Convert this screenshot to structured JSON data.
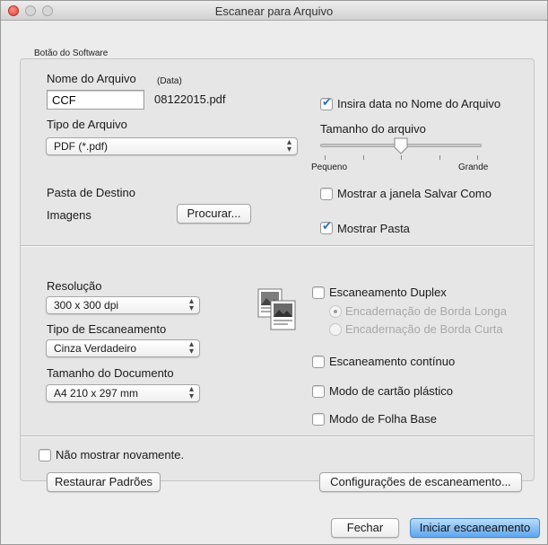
{
  "window": {
    "title": "Escanear para Arquivo"
  },
  "group": {
    "label": "Botão do Software"
  },
  "file": {
    "name_label": "Nome do Arquivo",
    "date_label": "(Data)",
    "name_value": "CCF",
    "date_file": "08122015.pdf",
    "insert_date_label": "Insira data no Nome do Arquivo",
    "insert_date_checked": true,
    "type_label": "Tipo de Arquivo",
    "type_value": "PDF (*.pdf)",
    "size_label": "Tamanho do arquivo",
    "size_small": "Pequeno",
    "size_large": "Grande",
    "size_level_fraction": 0.5
  },
  "destination": {
    "label": "Pasta de Destino",
    "folder": "Imagens",
    "browse_label": "Procurar...",
    "show_save_as_label": "Mostrar a janela Salvar Como",
    "show_save_as_checked": false,
    "show_folder_label": "Mostrar Pasta",
    "show_folder_checked": true
  },
  "scan": {
    "resolution_label": "Resolução",
    "resolution_value": "300 x 300 dpi",
    "scan_type_label": "Tipo de Escaneamento",
    "scan_type_value": "Cinza Verdadeiro",
    "doc_size_label": "Tamanho do Documento",
    "doc_size_value": "A4 210 x 297 mm",
    "duplex_label": "Escaneamento Duplex",
    "duplex_checked": false,
    "long_edge_label": "Encadernação de Borda Longa",
    "short_edge_label": "Encadernação de Borda Curta",
    "continuous_label": "Escaneamento contínuo",
    "continuous_checked": false,
    "plastic_card_label": "Modo de cartão plástico",
    "plastic_card_checked": false,
    "carrier_sheet_label": "Modo de Folha Base",
    "carrier_sheet_checked": false
  },
  "footer": {
    "dont_show_label": "Não mostrar novamente.",
    "dont_show_checked": false,
    "restore_label": "Restaurar Padrões",
    "settings_label": "Configurações de escaneamento...",
    "close_label": "Fechar",
    "start_label": "Iniciar escaneamento"
  },
  "colors": {
    "default_button": "#5ea6ee",
    "check_mark": "#2c6fc9"
  }
}
